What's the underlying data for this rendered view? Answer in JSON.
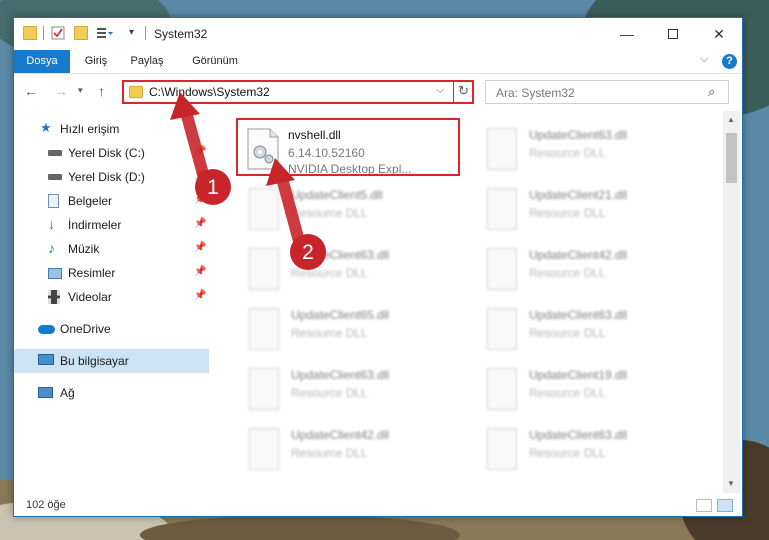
{
  "window": {
    "title": "System32",
    "minimize_icon": "minimize-icon",
    "maximize_icon": "maximize-icon",
    "close_icon": "close-icon"
  },
  "ribbon": {
    "tabs": [
      {
        "label": "Dosya",
        "active": true
      },
      {
        "label": "Giriş",
        "active": false
      },
      {
        "label": "Paylaş",
        "active": false
      },
      {
        "label": "Görünüm",
        "active": false
      }
    ],
    "help": "?"
  },
  "navigation": {
    "address": "C:\\Windows\\System32",
    "search_placeholder": "Ara: System32"
  },
  "sidebar": {
    "items": [
      {
        "label": "Hızlı erişim",
        "icon": "star-icon"
      },
      {
        "label": "Yerel Disk (C:)",
        "icon": "drive-icon",
        "pinned": true
      },
      {
        "label": "Yerel Disk (D:)",
        "icon": "drive-icon",
        "pinned": true
      },
      {
        "label": "Belgeler",
        "icon": "documents-icon",
        "pinned": true
      },
      {
        "label": "İndirmeler",
        "icon": "download-icon",
        "pinned": true
      },
      {
        "label": "Müzik",
        "icon": "music-icon",
        "pinned": true
      },
      {
        "label": "Resimler",
        "icon": "pictures-icon",
        "pinned": true
      },
      {
        "label": "Videolar",
        "icon": "videos-icon",
        "pinned": true
      },
      {
        "label": "OneDrive",
        "icon": "cloud-icon"
      },
      {
        "label": "Bu bilgisayar",
        "icon": "computer-icon",
        "selected": true
      },
      {
        "label": "Ağ",
        "icon": "network-icon"
      }
    ]
  },
  "files": [
    {
      "name": "nvshell.dll",
      "version": "6.14.10.52160",
      "description": "NVIDIA Desktop Expl...",
      "highlighted": true
    },
    {
      "name": "UpdateClient63.dll",
      "description": "Resource DLL"
    },
    {
      "name": "UpdateClient5.dll",
      "description": "Resource DLL"
    },
    {
      "name": "UpdateClient21.dll",
      "description": "Resource DLL"
    },
    {
      "name": "UpdateClient63.dll",
      "description": "Resource DLL"
    },
    {
      "name": "UpdateClient42.dll",
      "description": "Resource DLL"
    },
    {
      "name": "UpdateClient65.dll",
      "description": "Resource DLL"
    },
    {
      "name": "UpdateClient63.dll",
      "description": "Resource DLL"
    },
    {
      "name": "UpdateClient63.dll",
      "description": "Resource DLL"
    },
    {
      "name": "UpdateClient19.dll",
      "description": "Resource DLL"
    },
    {
      "name": "UpdateClient42.dll",
      "description": "Resource DLL"
    },
    {
      "name": "UpdateClient63.dll",
      "description": "Resource DLL"
    }
  ],
  "status": {
    "item_count": "102 öğe"
  },
  "annotations": {
    "step1": "1",
    "step2": "2",
    "color": "#d9262d"
  },
  "colors": {
    "accent": "#1979ca",
    "highlight": "#d9262d",
    "selection": "#cce3f5"
  }
}
